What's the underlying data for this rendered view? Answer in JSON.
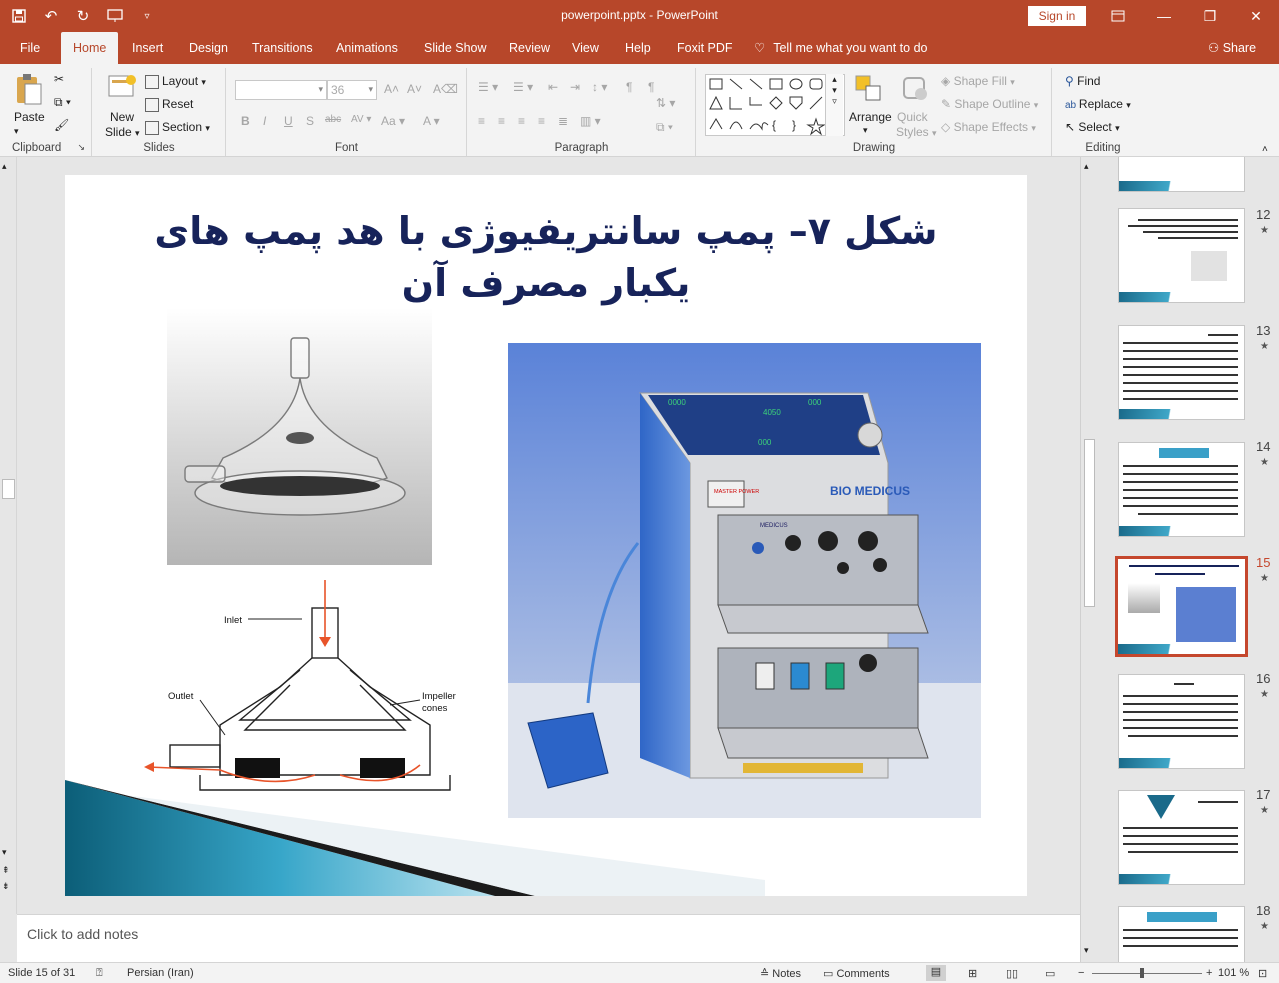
{
  "window": {
    "title": "powerpoint.pptx  -  PowerPoint",
    "signin_label": "Sign in"
  },
  "tabs": [
    {
      "label": "File"
    },
    {
      "label": "Home"
    },
    {
      "label": "Insert"
    },
    {
      "label": "Design"
    },
    {
      "label": "Transitions"
    },
    {
      "label": "Animations"
    },
    {
      "label": "Slide Show"
    },
    {
      "label": "Review"
    },
    {
      "label": "View"
    },
    {
      "label": "Help"
    },
    {
      "label": "Foxit PDF"
    }
  ],
  "tellme_label": "Tell me what you want to do",
  "share_label": "Share",
  "ribbon": {
    "clipboard": {
      "label": "Clipboard",
      "paste": "Paste"
    },
    "slides": {
      "label": "Slides",
      "new_slide": "New",
      "new_slide2": "Slide",
      "layout": "Layout",
      "reset": "Reset",
      "section": "Section"
    },
    "font": {
      "label": "Font",
      "size": "36"
    },
    "paragraph": {
      "label": "Paragraph"
    },
    "drawing": {
      "label": "Drawing",
      "arrange": "Arrange",
      "quick_styles": "Quick",
      "quick_styles2": "Styles",
      "shape_fill": "Shape Fill",
      "shape_outline": "Shape Outline",
      "shape_effects": "Shape Effects"
    },
    "editing": {
      "label": "Editing",
      "find": "Find",
      "replace": "Replace",
      "select": "Select"
    }
  },
  "slide": {
    "title": "شکل ۷– پمپ سانتریفیوژی با هد پمپ های یکبار مصرف آن",
    "diagram": {
      "inlet": "Inlet",
      "outlet": "Outlet",
      "impeller": "Impeller",
      "cones": "cones"
    },
    "machine": {
      "brand": "BIO MEDICUS",
      "panel_brand": "MEDICUS",
      "master_power": "MASTER POWER"
    }
  },
  "thumbnails": [
    {
      "num": "12",
      "star": "★"
    },
    {
      "num": "13",
      "star": "★"
    },
    {
      "num": "14",
      "star": "★"
    },
    {
      "num": "15",
      "star": "★"
    },
    {
      "num": "16",
      "star": "★"
    },
    {
      "num": "17",
      "star": "★"
    },
    {
      "num": "18",
      "star": "★"
    }
  ],
  "notes_placeholder": "Click to add notes",
  "status": {
    "slide_info": "Slide 15 of 31",
    "language": "Persian (Iran)",
    "notes": "Notes",
    "comments": "Comments",
    "zoom": "101 %"
  },
  "colors": {
    "accent": "#b7472a",
    "selected_thumb": "#c5472d",
    "title_text": "#17235a"
  }
}
